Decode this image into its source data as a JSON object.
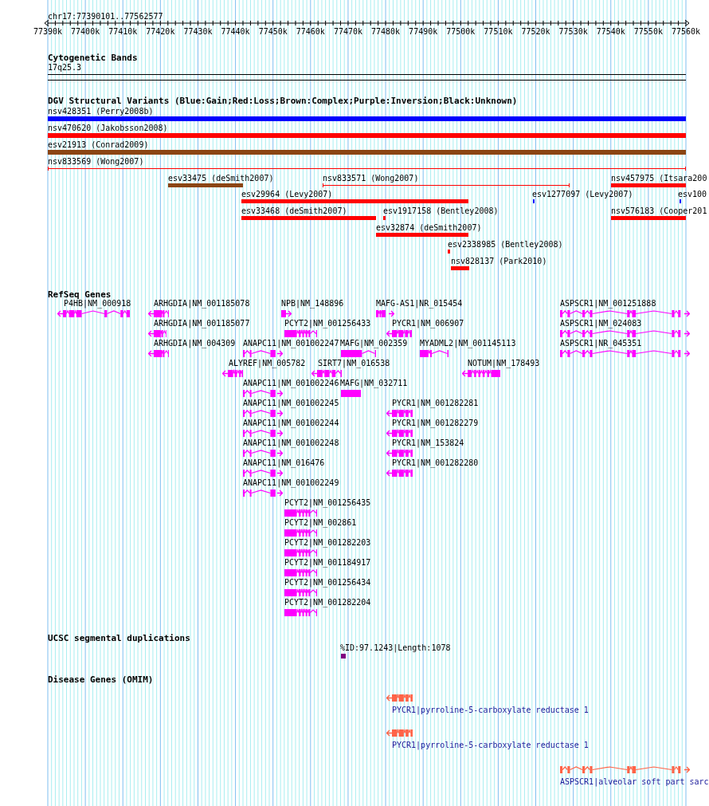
{
  "ruler": {
    "label": "chr17:77390101..77562577",
    "ticks": [
      "77390k",
      "77400k",
      "77410k",
      "77420k",
      "77430k",
      "77440k",
      "77450k",
      "77460k",
      "77470k",
      "77480k",
      "77490k",
      "77500k",
      "77510k",
      "77520k",
      "77530k",
      "77540k",
      "77550k",
      "77560k"
    ]
  },
  "tracks": [
    {
      "kind": "cytoband",
      "title": "Cytogenetic Bands",
      "features": [
        {
          "label": "17q25.3"
        }
      ]
    },
    {
      "kind": "variants",
      "title": "DGV Structural Variants (Blue:Gain;Red:Loss;Brown:Complex;Purple:Inversion;Black:Unknown)",
      "features": [
        {
          "label": "nsv428351 (Perry2008b)",
          "kind": "bar",
          "color": "#0000ff"
        },
        {
          "label": "nsv470620 (Jakobsson2008)",
          "kind": "bar",
          "color": "#ff0000"
        },
        {
          "label": "esv21913 (Conrad2009)",
          "kind": "bar",
          "color": "#8b4513"
        },
        {
          "label": "nsv833569 (Wong2007)",
          "kind": "line",
          "color": "#ff0000"
        },
        {
          "label": "esv33475 (deSmith2007)",
          "kind": "bar",
          "color": "#8b4513"
        },
        {
          "label": "nsv833571 (Wong2007)",
          "kind": "line",
          "color": "#ff0000"
        },
        {
          "label": "nsv457975 (Itsara200",
          "kind": "bar",
          "color": "#ff0000"
        },
        {
          "label": "esv29964 (Levy2007)",
          "kind": "bar",
          "color": "#ff0000"
        },
        {
          "label": "esv1277097 (Levy2007)",
          "kind": "bar",
          "color": "#0000ff"
        },
        {
          "label": "esv100",
          "kind": "bar",
          "color": "#0000ff"
        },
        {
          "label": "esv33468 (deSmith2007)",
          "kind": "bar",
          "color": "#ff0000"
        },
        {
          "label": "esv1917158 (Bentley2008)",
          "kind": "bar",
          "color": "#ff0000"
        },
        {
          "label": "nsv576183 (Cooper201",
          "kind": "bar",
          "color": "#ff0000"
        },
        {
          "label": "esv32874 (deSmith2007)",
          "kind": "bar",
          "color": "#ff0000"
        },
        {
          "label": "esv2338985 (Bentley2008)",
          "kind": "bar",
          "color": "#ff0000"
        },
        {
          "label": "nsv828137 (Park2010)",
          "kind": "bar",
          "color": "#ff0000"
        }
      ]
    },
    {
      "kind": "genes",
      "title": "RefSeq Genes",
      "features": [
        {
          "label": "P4HB|NM_000918",
          "kind": "reverse"
        },
        {
          "label": "ARHGDIA|NM_001185078",
          "kind": "reverse"
        },
        {
          "label": "NPB|NM_148896",
          "kind": "forward"
        },
        {
          "label": "MAFG-AS1|NR_015454",
          "kind": "forward"
        },
        {
          "label": "ASPSCR1|NM_001251888",
          "kind": "forward"
        },
        {
          "label": "ARHGDIA|NM_001185077",
          "kind": "reverse"
        },
        {
          "label": "PCYT2|NM_001256433",
          "kind": "plain"
        },
        {
          "label": "PYCR1|NM_006907",
          "kind": "reverse"
        },
        {
          "label": "ASPSCR1|NM_024083",
          "kind": "forward"
        },
        {
          "label": "ARHGDIA|NM_004309",
          "kind": "reverse"
        },
        {
          "label": "ANAPC11|NM_001002247",
          "kind": "forward"
        },
        {
          "label": "MAFG|NM_002359",
          "kind": "plain"
        },
        {
          "label": "MYADML2|NM_001145113",
          "kind": "plain"
        },
        {
          "label": "ASPSCR1|NR_045351",
          "kind": "forward"
        },
        {
          "label": "ALYREF|NM_005782",
          "kind": "reverse"
        },
        {
          "label": "SIRT7|NM_016538",
          "kind": "reverse"
        },
        {
          "label": "NOTUM|NM_178493",
          "kind": "reverse"
        },
        {
          "label": "ANAPC11|NM_001002246",
          "kind": "forward"
        },
        {
          "label": "MAFG|NM_032711",
          "kind": "plain"
        },
        {
          "label": "ANAPC11|NM_001002245",
          "kind": "forward"
        },
        {
          "label": "PYCR1|NM_001282281",
          "kind": "reverse"
        },
        {
          "label": "ANAPC11|NM_001002244",
          "kind": "forward"
        },
        {
          "label": "PYCR1|NM_001282279",
          "kind": "reverse"
        },
        {
          "label": "ANAPC11|NM_001002248",
          "kind": "forward"
        },
        {
          "label": "PYCR1|NM_153824",
          "kind": "reverse"
        },
        {
          "label": "ANAPC11|NM_016476",
          "kind": "forward"
        },
        {
          "label": "PYCR1|NM_001282280",
          "kind": "reverse"
        },
        {
          "label": "ANAPC11|NM_001002249",
          "kind": "forward"
        },
        {
          "label": "PCYT2|NM_001256435",
          "kind": "plain"
        },
        {
          "label": "PCYT2|NM_002861",
          "kind": "plain"
        },
        {
          "label": "PCYT2|NM_001282203",
          "kind": "plain"
        },
        {
          "label": "PCYT2|NM_001184917",
          "kind": "plain"
        },
        {
          "label": "PCYT2|NM_001256434",
          "kind": "plain"
        },
        {
          "label": "PCYT2|NM_001282204",
          "kind": "plain"
        }
      ]
    },
    {
      "kind": "segdup",
      "title": "UCSC segmental duplications",
      "features": [
        {
          "label": "%ID:97.1243|Length:1078"
        }
      ]
    },
    {
      "kind": "disease",
      "title": "Disease Genes (OMIM)",
      "features": [
        {
          "label": "PYCR1|pyrroline-5-carboxylate reductase 1",
          "kind": "reverse"
        },
        {
          "label": "PYCR1|pyrroline-5-carboxylate reductase 1",
          "kind": "reverse"
        },
        {
          "label": "ASPSCR1|alveolar soft part sarc",
          "kind": "forward"
        }
      ]
    }
  ]
}
